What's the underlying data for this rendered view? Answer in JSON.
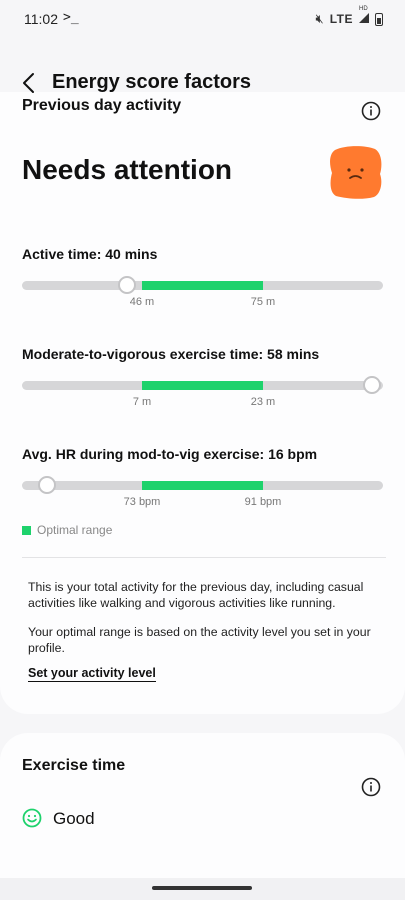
{
  "status": {
    "time": "11:02",
    "terminal": ">_",
    "network": "LTE",
    "signal_badge": "HD"
  },
  "header": {
    "title": "Energy score factors",
    "back_icon": "back-arrow-icon"
  },
  "section": {
    "title": "Previous day activity",
    "status": "Needs attention",
    "status_icon": "sad-face-icon",
    "status_icon_color": "#ff7a2f"
  },
  "metrics": [
    {
      "label": "Active time: 40 mins",
      "range_min_label": "46 m",
      "range_max_label": "75 m",
      "value_fraction": 0.29
    },
    {
      "label": "Moderate-to-vigorous exercise time: 58 mins",
      "range_min_label": "7 m",
      "range_max_label": "23 m",
      "value_fraction": 0.97
    },
    {
      "label": "Avg. HR during mod-to-vig exercise: 16 bpm",
      "range_min_label": "73 bpm",
      "range_max_label": "91 bpm",
      "value_fraction": 0.07
    }
  ],
  "legend": {
    "label": "Optimal range",
    "color": "#1ed26c"
  },
  "description": {
    "p1": "This is your total activity for the previous day, including casual activities like walking and vigorous activities like running.",
    "p2": "Your optimal range is based on the activity level you set in your profile.",
    "link": "Set your activity level"
  },
  "exercise": {
    "title": "Exercise time",
    "status": "Good",
    "status_icon": "smile-icon",
    "status_color": "#1ed26c"
  }
}
